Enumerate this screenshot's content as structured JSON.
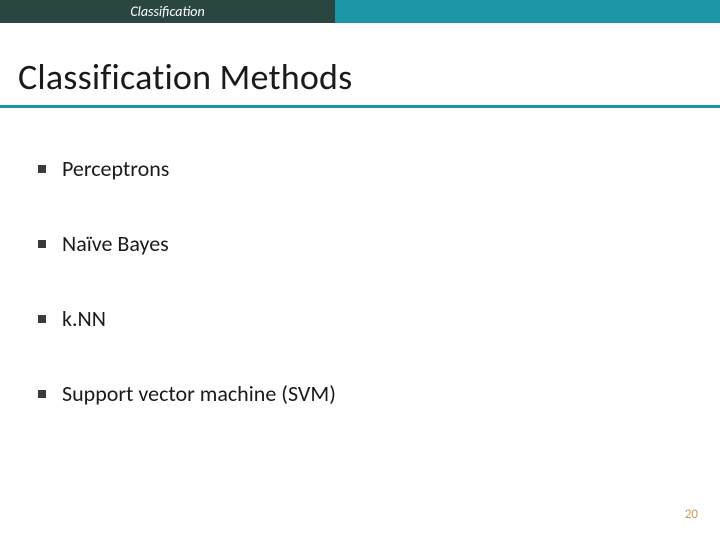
{
  "header": {
    "tab_label": "Classification"
  },
  "title": "Classification Methods",
  "bullets": [
    {
      "label": "Perceptrons"
    },
    {
      "label": "Naïve Bayes"
    },
    {
      "label": "k.NN"
    },
    {
      "label": "Support vector machine (SVM)"
    }
  ],
  "page_number": "20",
  "colors": {
    "accent": "#1c95a6",
    "tab_bg": "#2a4641",
    "page_num": "#c99a57"
  }
}
